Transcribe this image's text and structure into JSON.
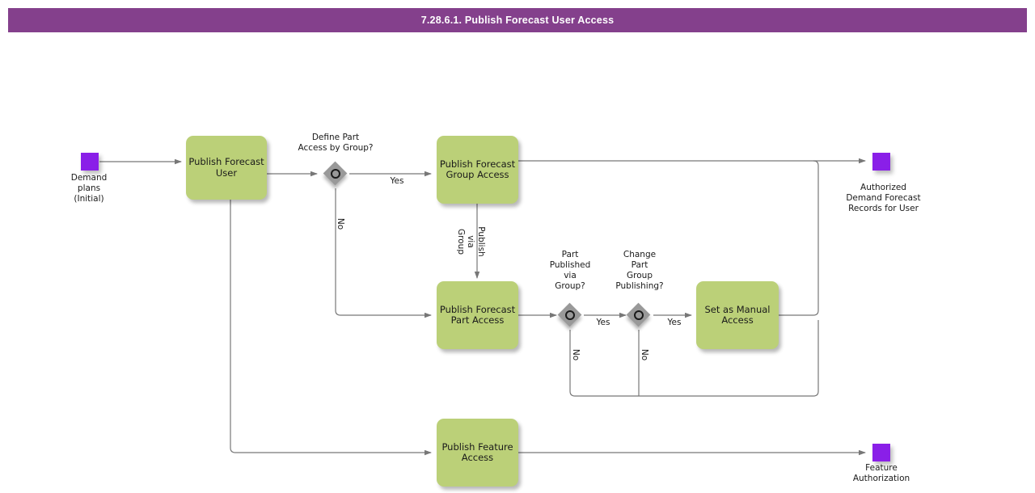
{
  "header": {
    "title": "7.28.6.1. Publish Forecast User Access",
    "bar_color": "#84408c",
    "text_color": "#ffffff"
  },
  "palette": {
    "task_fill": "#bbd078",
    "event_fill": "#8a1fe8",
    "gateway_fill": "#999999",
    "edge_color": "#666666",
    "text_color": "#1a1a1a"
  },
  "diagram": {
    "type": "bpmn-flowchart",
    "start_events": [
      {
        "id": "start-demand-plans",
        "label": "Demand\nplans\n(Initial)"
      }
    ],
    "end_events": [
      {
        "id": "end-authorized-records",
        "label": "Authorized\nDemand Forecast\nRecords for User"
      },
      {
        "id": "end-feature-authorization",
        "label": "Feature\nAuthorization"
      }
    ],
    "tasks": [
      {
        "id": "task-publish-forecast-user",
        "label": "Publish Forecast\nUser"
      },
      {
        "id": "task-publish-forecast-group-access",
        "label": "Publish Forecast\nGroup Access"
      },
      {
        "id": "task-publish-forecast-part-access",
        "label": "Publish Forecast\nPart Access"
      },
      {
        "id": "task-set-as-manual-access",
        "label": "Set as Manual\nAccess"
      },
      {
        "id": "task-publish-feature-access",
        "label": "Publish Feature\nAccess"
      }
    ],
    "gateways": [
      {
        "id": "gw-define-part-access",
        "label": "Define Part\nAccess by Group?"
      },
      {
        "id": "gw-part-published-via-group",
        "label": "Part\nPublished\nvia\nGroup?"
      },
      {
        "id": "gw-change-part-group-publishing",
        "label": "Change\nPart\nGroup\nPublishing?"
      }
    ],
    "edge_labels": [
      {
        "id": "edge-define-yes",
        "text": "Yes"
      },
      {
        "id": "edge-define-no",
        "text": "No"
      },
      {
        "id": "edge-publish-via-group",
        "text": "Publish\nvia\nGroup"
      },
      {
        "id": "edge-part-published-yes",
        "text": "Yes"
      },
      {
        "id": "edge-part-published-no",
        "text": "No"
      },
      {
        "id": "edge-change-group-yes",
        "text": "Yes"
      },
      {
        "id": "edge-change-group-no",
        "text": "No"
      }
    ]
  }
}
